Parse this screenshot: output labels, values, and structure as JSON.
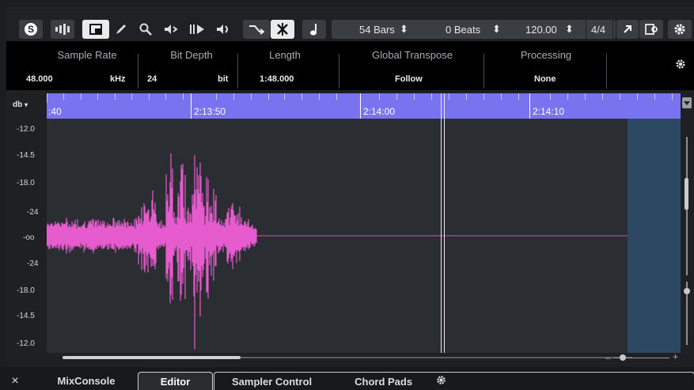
{
  "toolbar": {
    "bars_value": "54 Bars",
    "beats_value": "0 Beats",
    "tempo_value": "120.00",
    "signature_value": "4/4"
  },
  "info": {
    "sample_rate": {
      "label": "Sample Rate",
      "value": "48.000",
      "unit": "kHz"
    },
    "bit_depth": {
      "label": "Bit Depth",
      "value": "24",
      "unit": "bit"
    },
    "length": {
      "label": "Length",
      "value": "1:48.000"
    },
    "global_transpose": {
      "label": "Global Transpose",
      "value": "Follow"
    },
    "processing": {
      "label": "Processing",
      "value": "None"
    }
  },
  "ruler": {
    "labels": [
      ":40",
      "2:13:50",
      "2:14:00",
      "2:14:10"
    ]
  },
  "db_scale": {
    "header": "db",
    "labels": [
      "-12.0",
      "-14.5",
      "-18.0",
      "-24",
      "-oo",
      "-24",
      "-18.0",
      "-14.5",
      "-12.0"
    ]
  },
  "tabs": {
    "close": "×",
    "mixconsole": "MixConsole",
    "editor": "Editor",
    "sampler_control": "Sampler Control",
    "chord_pads": "Chord Pads"
  },
  "colors": {
    "waveform": "#e65ccf",
    "ruler": "#7a73f0",
    "selection": "#2c4762"
  }
}
